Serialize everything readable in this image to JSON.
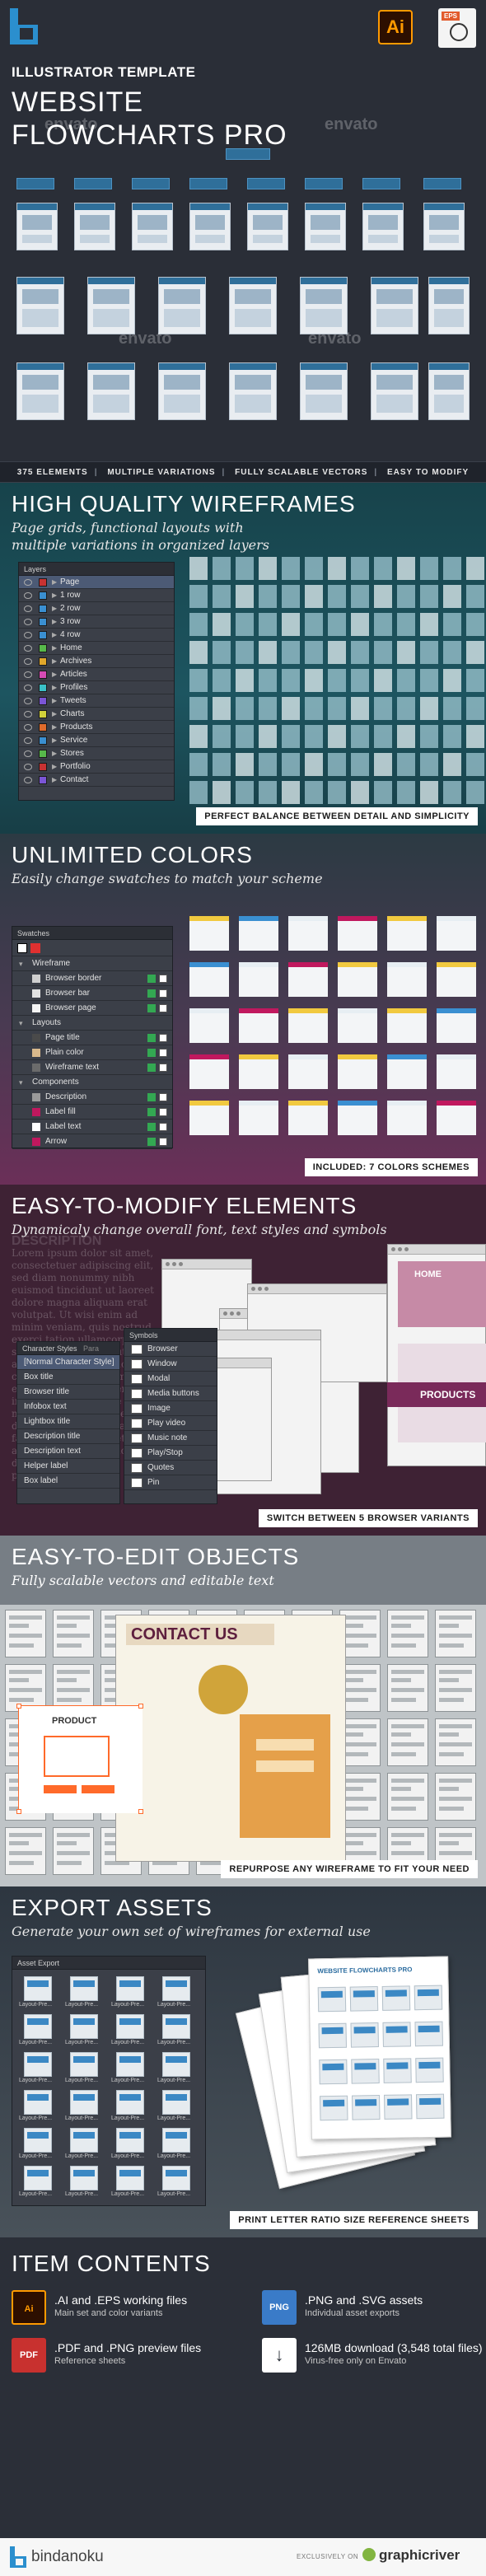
{
  "header": {
    "label": "ILLUSTRATOR TEMPLATE",
    "title_line1": "WEBSITE",
    "title_line2": "FLOWCHARTS PRO",
    "ai_badge": "Ai",
    "eps_badge": "EPS",
    "watermark": "envato",
    "features": [
      "375 ELEMENTS",
      "MULTIPLE VARIATIONS",
      "FULLY SCALABLE VECTORS",
      "EASY TO MODIFY"
    ]
  },
  "section1": {
    "title": "HIGH QUALITY WIREFRAMES",
    "subtitle": "Page grids, functional layouts with multiple variations in organized layers",
    "caption": "PERFECT BALANCE BETWEEN DETAIL AND SIMPLICITY",
    "layers_panel": {
      "title": "Layers",
      "rows": [
        "Page",
        "1 row",
        "2 row",
        "3 row",
        "4 row",
        "Home",
        "Archives",
        "Articles",
        "Profiles",
        "Tweets",
        "Charts",
        "Products",
        "Service",
        "Stores",
        "Portfolio",
        "Contact"
      ],
      "colors": [
        "#c83232",
        "#3a8fd1",
        "#3a8fd1",
        "#3a8fd1",
        "#3a8fd1",
        "#57b94a",
        "#e0a72b",
        "#d64bb5",
        "#3ac0c7",
        "#7b55d6",
        "#d1d13a",
        "#e06b2b",
        "#3a8fd1",
        "#57b94a",
        "#c83232",
        "#7b55d6"
      ]
    }
  },
  "section2": {
    "title": "UNLIMITED COLORS",
    "subtitle": "Easily change swatches to match your scheme",
    "caption": "INCLUDED: 7 COLORS SCHEMES",
    "swatches_panel": {
      "title": "Swatches",
      "rows": [
        {
          "label": "Wireframe",
          "indent": false,
          "color": "#555"
        },
        {
          "label": "Browser border",
          "indent": true,
          "color": "#cfcfcf"
        },
        {
          "label": "Browser bar",
          "indent": true,
          "color": "#e2e2e2"
        },
        {
          "label": "Browser page",
          "indent": true,
          "color": "#f4f4f4"
        },
        {
          "label": "Layouts",
          "indent": false,
          "color": "#555"
        },
        {
          "label": "Page title",
          "indent": true,
          "color": "#4a4a4a"
        },
        {
          "label": "Plain color",
          "indent": true,
          "color": "#d9b98c"
        },
        {
          "label": "Wireframe text",
          "indent": true,
          "color": "#6b6b6b"
        },
        {
          "label": "Components",
          "indent": false,
          "color": "#555"
        },
        {
          "label": "Description",
          "indent": true,
          "color": "#9a9a9a"
        },
        {
          "label": "Label fill",
          "indent": true,
          "color": "#c0185e"
        },
        {
          "label": "Label text",
          "indent": true,
          "color": "#ffffff"
        },
        {
          "label": "Arrow",
          "indent": true,
          "color": "#c0185e"
        }
      ]
    }
  },
  "section3": {
    "title": "EASY-TO-MODIFY ELEMENTS",
    "subtitle": "Dynamicaly change overall font, text styles and symbols",
    "bg_label": "DESCRIPTION",
    "lorem": "Lorem ipsum dolor sit amet, consectetuer adipiscing elit, sed diam nonummy nibh euismod tincidunt ut laoreet dolore magna aliquam erat volutpat. Ut wisi enim ad minim veniam, quis nostrud exerci tation ullamcorper suscipit lobortis nisl ut aliquip ex ea commodo consequat. Duis autem vel eum iriure dolor in hendrerit in vulputate velit esse molestie consequat, vel illum dolore eu feugiat nulla facilisis at vero eros et accumsan et iusto odio dignissim qui blandit praesent luptatum.",
    "home_label": "HOME",
    "products_label": "PRODUCTS",
    "caption": "SWITCH BETWEEN 5 BROWSER VARIANTS",
    "character_styles": {
      "title": "Character Styles",
      "tab2": "Para",
      "rows": [
        "[Normal Character Style]",
        "Box title",
        "Browser title",
        "Infobox text",
        "Lightbox title",
        "Description title",
        "Description text",
        "Helper label",
        "Box label"
      ]
    },
    "symbols": {
      "title": "Symbols",
      "rows": [
        "Browser",
        "Window",
        "Modal",
        "Media buttons",
        "Image",
        "Play video",
        "Music note",
        "Play/Stop",
        "Quotes",
        "Pin"
      ]
    }
  },
  "section4": {
    "title": "EASY-TO-EDIT OBJECTS",
    "subtitle": "Fully scalable vectors and editable text",
    "contact_label": "CONTACT US",
    "product_label": "PRODUCT",
    "caption": "REPURPOSE ANY WIREFRAME TO FIT YOUR NEED"
  },
  "section5": {
    "title": "EXPORT ASSETS",
    "subtitle": "Generate your own set of wireframes for external use",
    "panel_title": "Asset Export",
    "asset_label": "Layout-Pre...",
    "sheet_title": "WEBSITE FLOWCHARTS PRO",
    "caption": "PRINT LETTER RATIO SIZE REFERENCE SHEETS"
  },
  "section6": {
    "title": "ITEM CONTENTS",
    "items": [
      {
        "icon": "Ai",
        "title": ".AI and .EPS working files",
        "desc": "Main set and color variants",
        "color": "#ff9a00",
        "bg": "#2d0f00"
      },
      {
        "icon": "PNG",
        "title": ".PNG and .SVG assets",
        "desc": "Individual asset exports",
        "color": "#ffffff",
        "bg": "#3a7bc8"
      },
      {
        "icon": "PDF",
        "title": ".PDF and .PNG preview files",
        "desc": "Reference sheets",
        "color": "#ffffff",
        "bg": "#c8312f"
      },
      {
        "icon": "↓",
        "title": "126MB download (3,548 total files)",
        "desc": "Virus-free only on Envato",
        "color": "#2b2f38",
        "bg": "#ffffff"
      }
    ]
  },
  "footer": {
    "brand": "bindanoku",
    "exclusive": "EXCLUSIVELY ON",
    "market": "graphicriver"
  }
}
